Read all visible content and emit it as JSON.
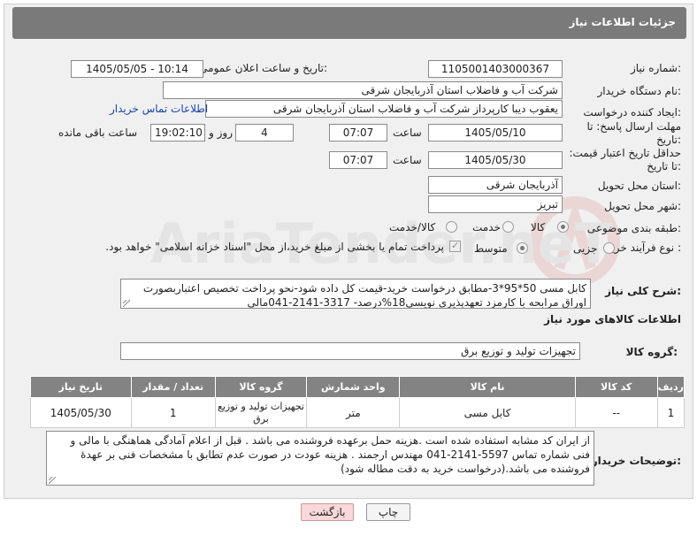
{
  "header": {
    "title": "جزئیات اطلاعات نیاز"
  },
  "form": {
    "need_number_label": "شماره نیاز:",
    "need_number": "1105001403000367",
    "announce_label": "تاریخ و ساعت اعلان عمومی:",
    "announce_value": "1405/05/05 - 10:14",
    "buyer_org_label": "نام دستگاه خریدار:",
    "buyer_org": "شرکت آب و فاضلاب استان آذربایجان شرقی",
    "creator_label": "ایجاد کننده درخواست:",
    "creator": "یعقوب دیبا کارپرداز شرکت آب و فاضلاب استان آذربایجان شرقی",
    "contact_link": "اطلاعات تماس خریدار",
    "reply_deadline_label": "مهلت ارسال پاسخ: تا تاریخ:",
    "reply_date": "1405/05/10",
    "time_label": "ساعت",
    "reply_time": "07:07",
    "days_value": "4",
    "days_label": "روز و",
    "remaining_time": "19:02:10",
    "remaining_label": "ساعت باقی مانده",
    "price_validity_label": "حداقل تاریخ اعتبار قیمت: تا تاریخ:",
    "price_date": "1405/05/30",
    "price_time": "07:07",
    "province_label": "استان محل تحویل:",
    "province": "آذربایجان شرقی",
    "city_label": "شهر محل تحویل:",
    "city": "تبریز",
    "category_label": "طبقه بندی موضوعی:",
    "category_options": [
      "کالا",
      "خدمت",
      "کالا/خدمت"
    ],
    "process_label": "نوع فرآیند خرید :",
    "process_options": [
      "جزیی",
      "متوسط"
    ],
    "payment_note": "پرداخت تمام یا بخشی از مبلغ خرید،از محل \"اسناد خزانه اسلامی\" خواهد بود."
  },
  "summary": {
    "label": "شرح کلی نیاز:",
    "text": "کابل مسی 50*95*3-مطابق درخواست خرید-قیمت کل داده شود-نحو پرداخت تخصیص اعتباربصورت اوراق مرابحه با کارمزد تعهدپذیری نویسی18%درصد- 3317-2141-041مالی"
  },
  "goods": {
    "section_title": "اطلاعات کالاهای مورد نیاز",
    "group_label": "گروه کالا:",
    "group_value": "تجهیزات تولید و توزیع برق",
    "columns": [
      "ردیف",
      "کد کالا",
      "نام کالا",
      "واحد شمارش",
      "گروه کالا",
      "تعداد / مقدار",
      "تاریخ نیاز"
    ],
    "rows": [
      {
        "row": "1",
        "code": "--",
        "name": "کابل مسی",
        "unit": "متر",
        "group": "تجهیزات تولید و توزیع برق",
        "qty": "1",
        "date": "1405/05/30"
      }
    ]
  },
  "buyer_notes": {
    "label": "توضیحات خریدار:",
    "text": "از ایران کد مشابه استفاده شده است .هزینه حمل برعهده فروشنده می باشد . قبل از اعلام آمادگی هماهنگی با مالی و فنی شماره تماس 5597-2141-041 مهندس ارجمند . هزینه عودت در صورت عدم تطابق با مشخصات فنی بر عهدهٔ فروشنده می باشد.(درخواست خرید به دقت مطاله شود)"
  },
  "buttons": {
    "print": "چاپ",
    "back": "بازگشت"
  },
  "watermark_text": "AriaTender.neT",
  "colors": {
    "header_bg": "#7a7a7a",
    "link": "#1a44b0",
    "back_btn_bg": "#f8d8d8",
    "watermark": "#c33"
  }
}
